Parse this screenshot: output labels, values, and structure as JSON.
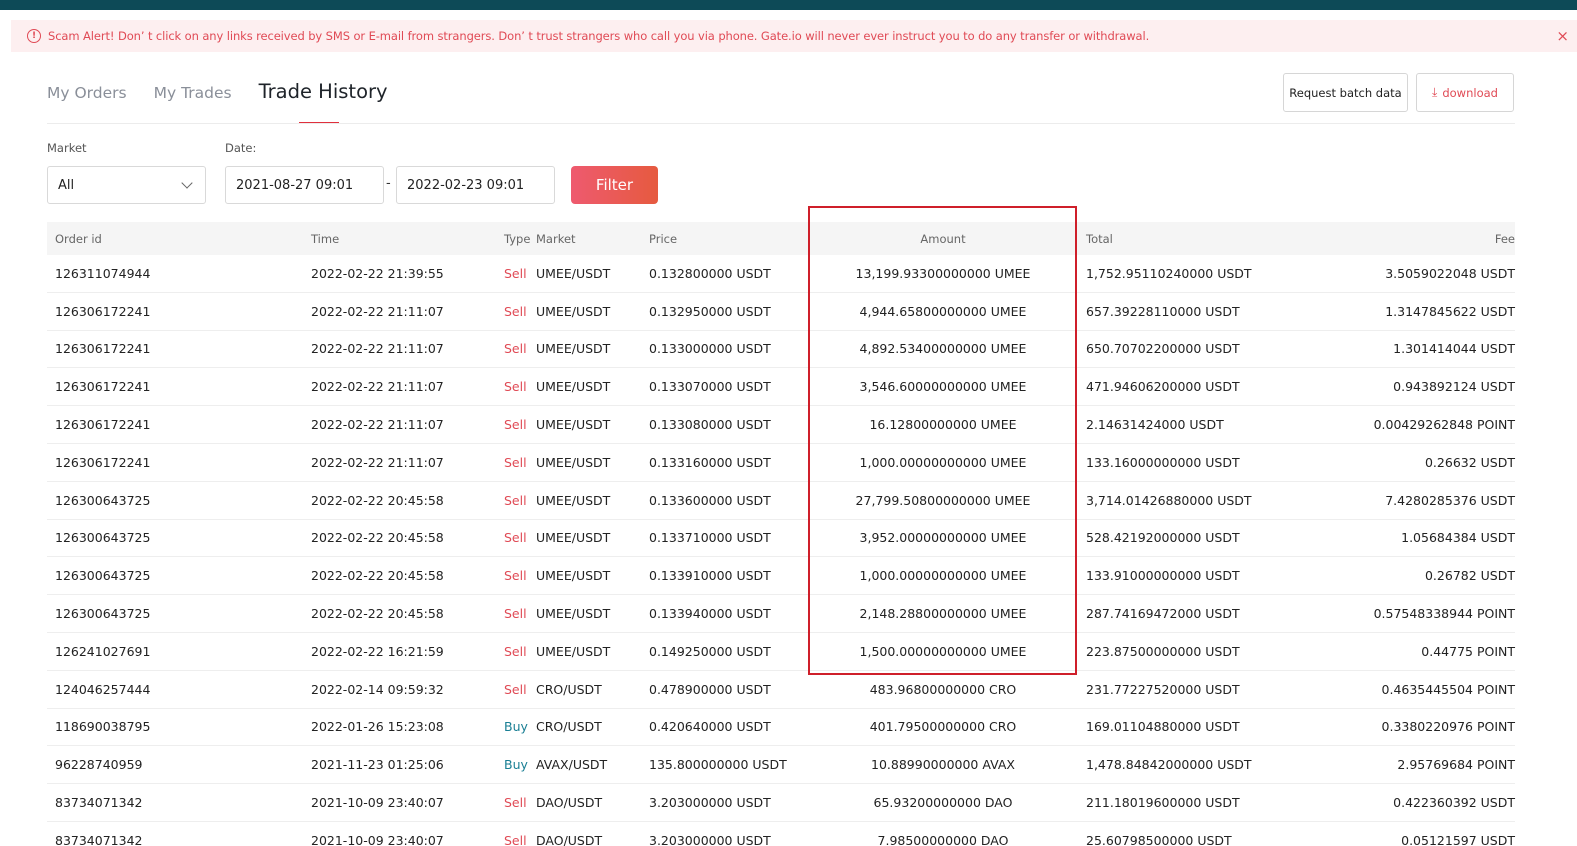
{
  "alert": {
    "text": "Scam Alert! Don’ t click on any links received by SMS or E-mail from strangers. Don’ t trust strangers who call you via phone. Gate.io will never ever instruct you to do any transfer or withdrawal.",
    "close": "×"
  },
  "tabs": [
    "My Orders",
    "My Trades",
    "Trade History"
  ],
  "actions": {
    "batch": "Request batch data",
    "download": "download"
  },
  "filters": {
    "market_label": "Market",
    "market_value": "All",
    "date_label": "Date:",
    "date_from": "2021-08-27 09:01",
    "date_to": "2022-02-23 09:01",
    "separator": "-",
    "filter_button": "Filter"
  },
  "table": {
    "headers": {
      "order_id": "Order id",
      "time": "Time",
      "type": "Type",
      "market": "Market",
      "price": "Price",
      "amount": "Amount",
      "total": "Total",
      "fee": "Fee"
    },
    "rows": [
      [
        "126311074944",
        "2022-02-22 21:39:55",
        "Sell",
        "UMEE/USDT",
        "0.132800000 USDT",
        "13,199.93300000000 UMEE",
        "1,752.95110240000 USDT",
        "3.5059022048 USDT"
      ],
      [
        "126306172241",
        "2022-02-22 21:11:07",
        "Sell",
        "UMEE/USDT",
        "0.132950000 USDT",
        "4,944.65800000000 UMEE",
        "657.39228110000 USDT",
        "1.3147845622 USDT"
      ],
      [
        "126306172241",
        "2022-02-22 21:11:07",
        "Sell",
        "UMEE/USDT",
        "0.133000000 USDT",
        "4,892.53400000000 UMEE",
        "650.70702200000 USDT",
        "1.301414044 USDT"
      ],
      [
        "126306172241",
        "2022-02-22 21:11:07",
        "Sell",
        "UMEE/USDT",
        "0.133070000 USDT",
        "3,546.60000000000 UMEE",
        "471.94606200000 USDT",
        "0.943892124 USDT"
      ],
      [
        "126306172241",
        "2022-02-22 21:11:07",
        "Sell",
        "UMEE/USDT",
        "0.133080000 USDT",
        "16.12800000000 UMEE",
        "2.14631424000 USDT",
        "0.00429262848 POINT"
      ],
      [
        "126306172241",
        "2022-02-22 21:11:07",
        "Sell",
        "UMEE/USDT",
        "0.133160000 USDT",
        "1,000.00000000000 UMEE",
        "133.16000000000 USDT",
        "0.26632 USDT"
      ],
      [
        "126300643725",
        "2022-02-22 20:45:58",
        "Sell",
        "UMEE/USDT",
        "0.133600000 USDT",
        "27,799.50800000000 UMEE",
        "3,714.01426880000 USDT",
        "7.4280285376 USDT"
      ],
      [
        "126300643725",
        "2022-02-22 20:45:58",
        "Sell",
        "UMEE/USDT",
        "0.133710000 USDT",
        "3,952.00000000000 UMEE",
        "528.42192000000 USDT",
        "1.05684384 USDT"
      ],
      [
        "126300643725",
        "2022-02-22 20:45:58",
        "Sell",
        "UMEE/USDT",
        "0.133910000 USDT",
        "1,000.00000000000 UMEE",
        "133.91000000000 USDT",
        "0.26782 USDT"
      ],
      [
        "126300643725",
        "2022-02-22 20:45:58",
        "Sell",
        "UMEE/USDT",
        "0.133940000 USDT",
        "2,148.28800000000 UMEE",
        "287.74169472000 USDT",
        "0.57548338944 POINT"
      ],
      [
        "126241027691",
        "2022-02-22 16:21:59",
        "Sell",
        "UMEE/USDT",
        "0.149250000 USDT",
        "1,500.00000000000 UMEE",
        "223.87500000000 USDT",
        "0.44775 POINT"
      ],
      [
        "124046257444",
        "2022-02-14 09:59:32",
        "Sell",
        "CRO/USDT",
        "0.478900000 USDT",
        "483.96800000000 CRO",
        "231.77227520000 USDT",
        "0.4635445504 POINT"
      ],
      [
        "118690038795",
        "2022-01-26 15:23:08",
        "Buy",
        "CRO/USDT",
        "0.420640000 USDT",
        "401.79500000000 CRO",
        "169.01104880000 USDT",
        "0.3380220976 POINT"
      ],
      [
        "96228740959",
        "2021-11-23 01:25:06",
        "Buy",
        "AVAX/USDT",
        "135.800000000 USDT",
        "10.88990000000 AVAX",
        "1,478.84842000000 USDT",
        "2.95769684 POINT"
      ],
      [
        "83734071342",
        "2021-10-09 23:40:07",
        "Sell",
        "DAO/USDT",
        "3.203000000 USDT",
        "65.93200000000 DAO",
        "211.18019600000 USDT",
        "0.422360392 USDT"
      ],
      [
        "83734071342",
        "2021-10-09 23:40:07",
        "Sell",
        "DAO/USDT",
        "3.203000000 USDT",
        "7.98500000000 DAO",
        "25.60798500000 USDT",
        "0.05121597 USDT"
      ]
    ]
  },
  "colors": {
    "sell": "#e04a55",
    "buy": "#1a7f94",
    "accent": "#e0303d",
    "highlight_box": "#cf1f2a"
  }
}
